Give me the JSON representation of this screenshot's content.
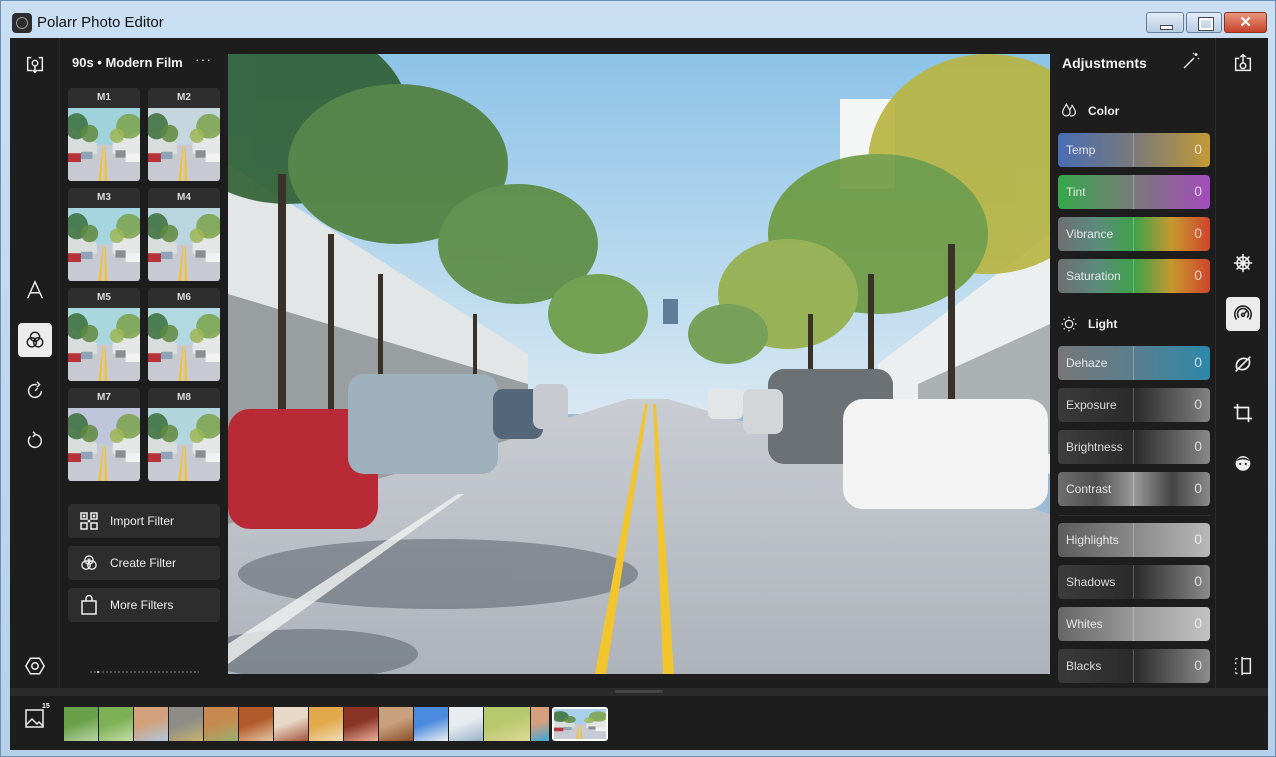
{
  "window": {
    "title": "Polarr Photo Editor",
    "controls": {
      "minimize": "minimize",
      "maximize": "maximize",
      "close": "✕"
    }
  },
  "left_rail": {
    "items": [
      {
        "name": "import-photo",
        "icon": "import-photo-icon"
      },
      {
        "name": "text",
        "icon": "text-tool-icon",
        "glyph": "A"
      },
      {
        "name": "filters",
        "icon": "filters-icon",
        "active": true
      },
      {
        "name": "history",
        "icon": "history-icon"
      },
      {
        "name": "undo",
        "icon": "undo-icon"
      },
      {
        "name": "settings",
        "icon": "settings-hex-icon"
      }
    ]
  },
  "filters": {
    "collection_title": "90s • Modern Film",
    "more_label": "···",
    "items": [
      {
        "label": "M1",
        "tint": "#9ed3dc"
      },
      {
        "label": "M2",
        "tint": "#c6d6df"
      },
      {
        "label": "M3",
        "tint": "#a5d6e0"
      },
      {
        "label": "M4",
        "tint": "#b9d6df"
      },
      {
        "label": "M5",
        "tint": "#a9d7df"
      },
      {
        "label": "M6",
        "tint": "#b2d8e2"
      },
      {
        "label": "M7",
        "tint": "#bfc6dc"
      },
      {
        "label": "M8",
        "tint": "#b2d6dc"
      }
    ],
    "actions": [
      {
        "label": "Import Filter",
        "icon": "qr-import-icon"
      },
      {
        "label": "Create Filter",
        "icon": "create-filter-icon"
      },
      {
        "label": "More Filters",
        "icon": "shopping-bag-icon"
      }
    ],
    "page_indicator": {
      "current": 1,
      "total": 28
    }
  },
  "canvas": {
    "description": "Street lined with palm trees and parked cars, yellow center lines"
  },
  "adjustments": {
    "title": "Adjustments",
    "auto_icon": "magic-wand-icon",
    "sections": [
      {
        "name": "Color",
        "icon": "color-drops-icon",
        "sliders": [
          {
            "label": "Temp",
            "value": "0",
            "gradient": [
              "#4a6db6",
              "#7a7a7a",
              "#c29a36"
            ]
          },
          {
            "label": "Tint",
            "value": "0",
            "gradient": [
              "#34a84a",
              "#7a7a7a",
              "#a44bbd"
            ]
          },
          {
            "label": "Vibrance",
            "value": "0",
            "gradient": [
              "#6f6f6f",
              "#5c8a7e",
              "#3fa24a",
              "#c6982e",
              "#d0452c"
            ]
          },
          {
            "label": "Saturation",
            "value": "0",
            "gradient": [
              "#6f6f6f",
              "#5c8a7e",
              "#3fa24a",
              "#c6982e",
              "#d0452c"
            ]
          }
        ]
      },
      {
        "name": "Light",
        "icon": "sun-icon",
        "sliders": [
          {
            "label": "Dehaze",
            "value": "0",
            "gradient": [
              "#777777",
              "#5a7e8e",
              "#2c88aa"
            ]
          },
          {
            "label": "Exposure",
            "value": "0",
            "gradient": [
              "#3a3a3a",
              "#2a2a2a",
              "#828282"
            ]
          },
          {
            "label": "Brightness",
            "value": "0",
            "gradient": [
              "#3e3e3e",
              "#2a2a2a",
              "#888888"
            ]
          },
          {
            "label": "Contrast",
            "value": "0",
            "gradient": [
              "#6e6e6e",
              "#505050",
              "#9a9a9a",
              "#444444",
              "#8a8a8a"
            ]
          },
          {
            "label": "Highlights",
            "value": "0",
            "gradient": [
              "#5c5c5c",
              "#8a8a8a",
              "#b8b8b8"
            ]
          },
          {
            "label": "Shadows",
            "value": "0",
            "gradient": [
              "#3c3c3c",
              "#2a2a2a",
              "#8a8a8a"
            ]
          },
          {
            "label": "Whites",
            "value": "0",
            "gradient": [
              "#666666",
              "#999999",
              "#c2c2c2"
            ]
          },
          {
            "label": "Blacks",
            "value": "0",
            "gradient": [
              "#3a3a3a",
              "#2a2a2a",
              "#8c8c8c"
            ]
          }
        ]
      }
    ]
  },
  "right_rail": {
    "items": [
      {
        "name": "export",
        "icon": "export-icon"
      },
      {
        "name": "presets",
        "icon": "wheel-icon"
      },
      {
        "name": "adjust",
        "icon": "dial-icon",
        "active": true
      },
      {
        "name": "brush",
        "icon": "brush-mask-icon"
      },
      {
        "name": "crop",
        "icon": "crop-icon"
      },
      {
        "name": "face",
        "icon": "face-icon"
      },
      {
        "name": "compare",
        "icon": "compare-split-icon"
      }
    ]
  },
  "filmstrip": {
    "photo_count": "15",
    "thumbnails": [
      {
        "colors": [
          "#6aa04a",
          "#bcd7a8"
        ]
      },
      {
        "colors": [
          "#7eb156",
          "#c5dca8"
        ]
      },
      {
        "colors": [
          "#d2a07a",
          "#aec8e0"
        ]
      },
      {
        "colors": [
          "#8d8c86",
          "#c7b36f"
        ]
      },
      {
        "colors": [
          "#c78a4e",
          "#98b070"
        ]
      },
      {
        "colors": [
          "#b35a2b",
          "#e5c7a6"
        ]
      },
      {
        "colors": [
          "#e8d8c6",
          "#a3553d"
        ]
      },
      {
        "colors": [
          "#e1a94a",
          "#f1dcb8"
        ]
      },
      {
        "colors": [
          "#8a3426",
          "#e9b39a"
        ]
      },
      {
        "colors": [
          "#c8a17c",
          "#8a4d2a"
        ]
      },
      {
        "colors": [
          "#4a8adf",
          "#f1f1f1"
        ]
      },
      {
        "colors": [
          "#e8ecef",
          "#9ab2cc"
        ]
      },
      {
        "colors": [
          "#b7c96c",
          "#e0d79a"
        ],
        "wide": true
      },
      {
        "colors": [
          "#d7a07c",
          "#39a8d8"
        ],
        "narrow": true
      },
      {
        "colors": [
          "#8db3cf",
          "#c7c3bd"
        ],
        "selected": true
      }
    ]
  }
}
